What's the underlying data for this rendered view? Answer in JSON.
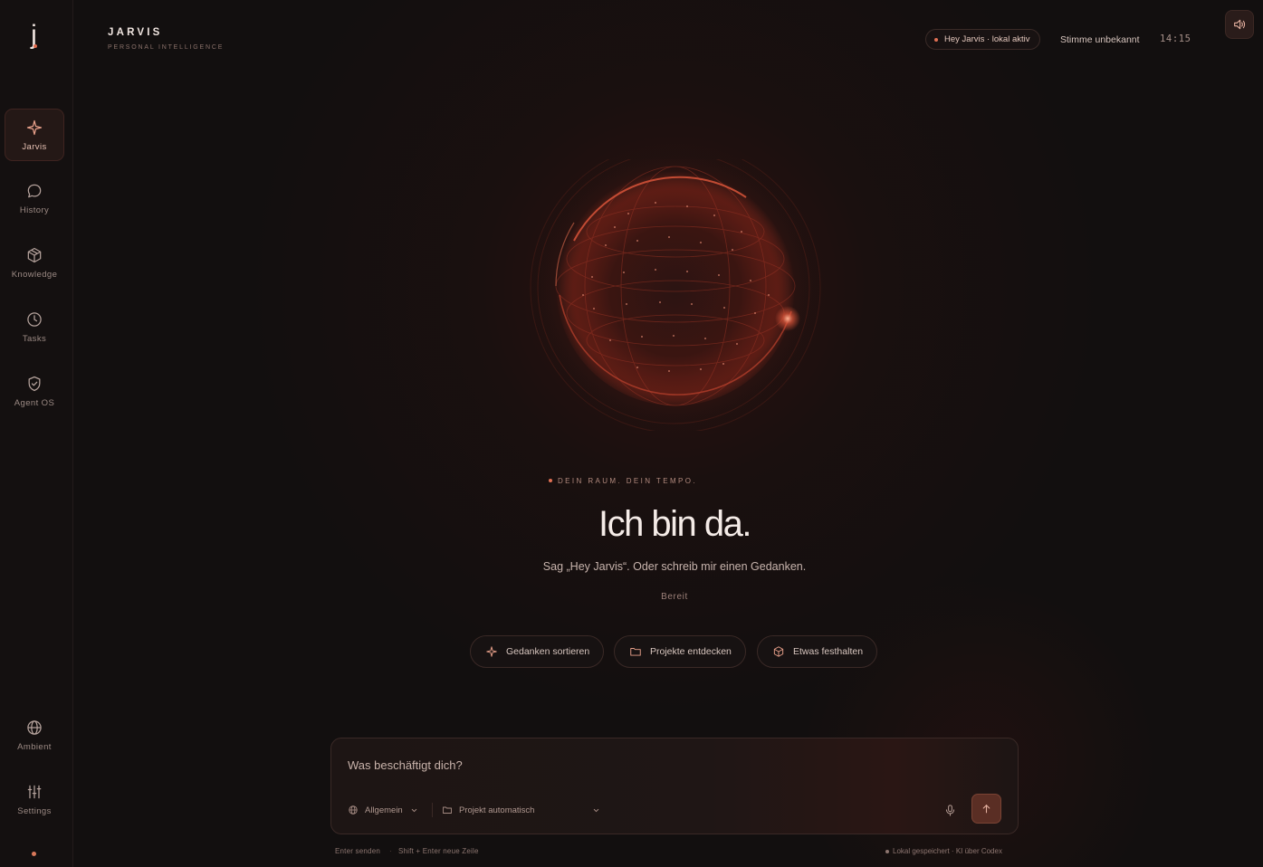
{
  "app": {
    "logo": "j",
    "brand_title": "JARVIS",
    "brand_subtitle": "PERSONAL INTELLIGENCE"
  },
  "sidebar": {
    "items": [
      {
        "label": "Jarvis",
        "icon": "sparkle-icon",
        "active": true
      },
      {
        "label": "History",
        "icon": "chat-bubble-icon"
      },
      {
        "label": "Knowledge",
        "icon": "box-icon"
      },
      {
        "label": "Tasks",
        "icon": "clock-icon"
      },
      {
        "label": "Agent OS",
        "icon": "shield-check-icon"
      }
    ],
    "bottom_items": [
      {
        "label": "Ambient",
        "icon": "globe-icon"
      },
      {
        "label": "Settings",
        "icon": "sliders-icon"
      }
    ]
  },
  "header": {
    "wake_status": "Hey Jarvis · lokal aktiv",
    "voice_status": "Stimme unbekannt",
    "clock": "14:15",
    "sound_icon": "speaker-icon"
  },
  "hero": {
    "eyebrow": "DEIN RAUM. DEIN TEMPO.",
    "headline": "Ich bin da.",
    "subline": "Sag „Hey Jarvis“. Oder schreib mir einen Gedanken.",
    "state": "Bereit"
  },
  "suggestions": [
    {
      "label": "Gedanken sortieren",
      "icon": "sparkle-icon"
    },
    {
      "label": "Projekte entdecken",
      "icon": "folder-icon"
    },
    {
      "label": "Etwas festhalten",
      "icon": "box-icon"
    }
  ],
  "composer": {
    "placeholder": "Was beschäftigt dich?",
    "mode": "Allgemein",
    "project": "Projekt automatisch"
  },
  "footer": {
    "hint_send": "Enter senden",
    "hint_newline": "Shift + Enter neue Zeile",
    "status": "Lokal gespeichert · KI über Codex"
  },
  "colors": {
    "accent": "#e07054",
    "background": "#120f0f",
    "send_button": "#5a2e24"
  }
}
